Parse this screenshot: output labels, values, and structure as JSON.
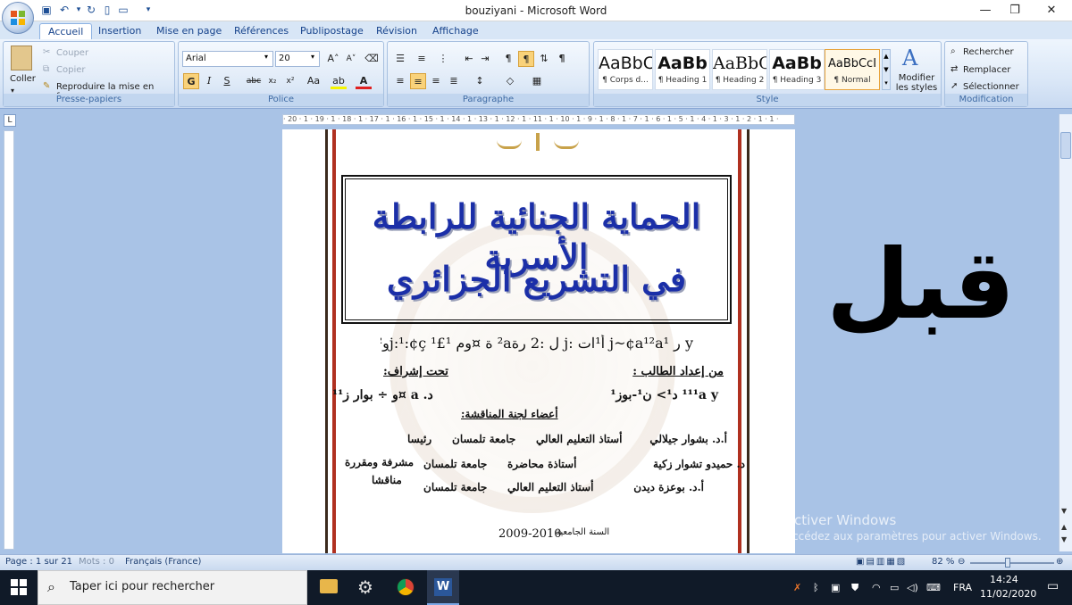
{
  "window": {
    "title": "bouziyani - Microsoft Word"
  },
  "tabs": [
    {
      "label": "Accueil"
    },
    {
      "label": "Insertion"
    },
    {
      "label": "Mise en page"
    },
    {
      "label": "Références"
    },
    {
      "label": "Publipostage"
    },
    {
      "label": "Révision"
    },
    {
      "label": "Affichage"
    }
  ],
  "clipboard": {
    "paste": "Coller",
    "cut": "Couper",
    "copy": "Copier",
    "format_painter": "Reproduire la mise en forme",
    "group_label": "Presse-papiers"
  },
  "font": {
    "name": "Arial",
    "size": "20",
    "group_label": "Police",
    "bold": "G",
    "italic": "I",
    "underline": "S",
    "case": "Aa"
  },
  "paragraph": {
    "group_label": "Paragraphe"
  },
  "styles": {
    "group_label": "Style",
    "items": [
      {
        "preview": "AaBbCc",
        "name": "¶ Corps d..."
      },
      {
        "preview": "AaBb",
        "name": "¶ Heading 1"
      },
      {
        "preview": "AaBbC",
        "name": "¶ Heading 2"
      },
      {
        "preview": "AaBb",
        "name": "¶ Heading 3"
      },
      {
        "preview": "AaBbCcI",
        "name": "¶ Normal"
      }
    ],
    "modify_label": "Modifier les styles"
  },
  "editing": {
    "group_label": "Modification",
    "find": "Rechercher",
    "replace": "Remplacer",
    "select": "Sélectionner"
  },
  "ruler": {
    "ticks": "· 20 · 1 · 19 · 1 · 18 · 1 · 17 · 1 · 16 · 1 · 15 · 1 · 14 · 1 · 13 · 1 · 12 · 1 · 11 · 1 · 10 · 1 · 9 · 1 · 8 · 1 · 7 · 1 · 6 · 1 · 5 · 1 · 4 · 1 · 3 · 1 · 2 · 1 · 1 ·"
  },
  "document": {
    "title_line1": "الحماية الجنائية للرابطة الأسرية",
    "title_line2": "في التشريع الجزائري",
    "garbled_line": "y ر j~¢a¹²a¹ أ¹ات :j ل :2 رة²a ة ¤وم ¹£j:¹:¢ç ¹و²ج¤اeç ام",
    "prepared_by_label": "من إعداد الطالب :",
    "supervised_by_label": "تحت إشراف:",
    "student_name": "¹¹¹a y د¹> ن¹-بوز¹",
    "supervisor_name": "د. a ¤و ÷ بوار ز¹¹",
    "committee_label": "أعضاء لجنة المناقشة:",
    "members": [
      {
        "name": "أ.د. بشوار جيلالي",
        "title": "أستاذ التعليم العالي",
        "univ": "جامعة تلمسان",
        "role": "رئيسا"
      },
      {
        "name": "د. حميدو تشوار زكية",
        "title": "أستاذة محاضرة",
        "univ": "جامعة تلمسان",
        "role": "مشرفة ومقررة"
      },
      {
        "name": "أ.د. بوعزة ديدن",
        "title": "أستاذ التعليم العالي",
        "univ": "جامعة تلمسان",
        "role": "مناقشا"
      }
    ],
    "year_label": "السنة الجامعية",
    "year": "2009-2010"
  },
  "overlay_text": "قبل",
  "activation": {
    "line1": "Activer Windows",
    "line2": "Accédez aux paramètres pour activer Windows."
  },
  "status": {
    "page": "Page : 1 sur 21",
    "words": "Mots : 0",
    "language": "Français (France)",
    "zoom": "82 %"
  },
  "taskbar": {
    "search_placeholder": "Taper ici pour rechercher",
    "lang": "FRA",
    "time": "14:24",
    "date": "11/02/2020"
  }
}
